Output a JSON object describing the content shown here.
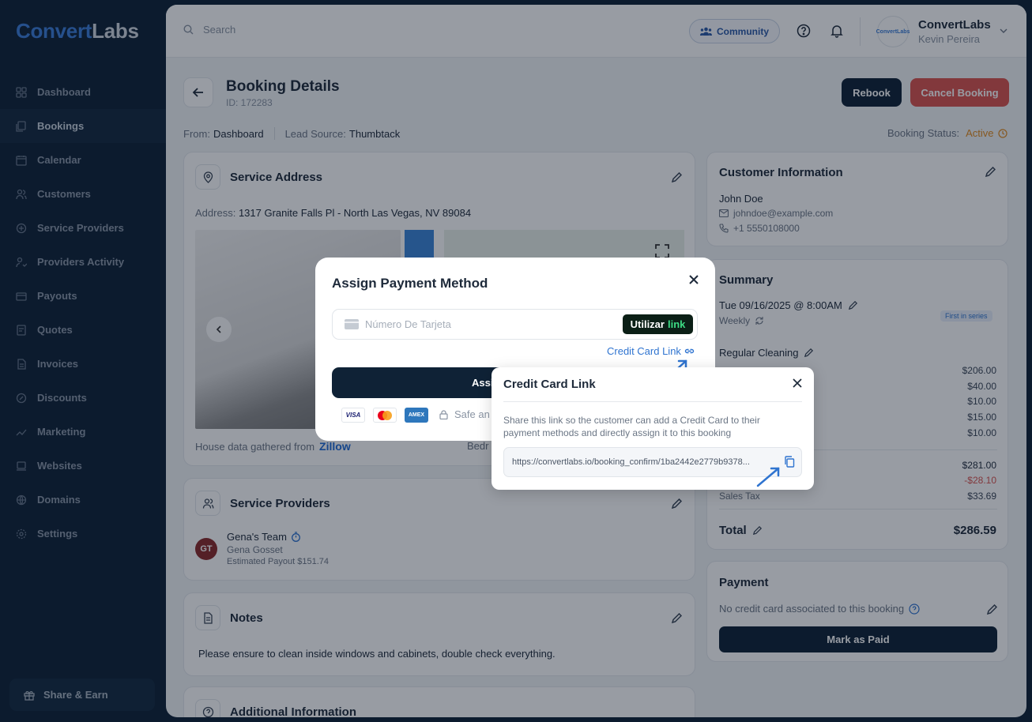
{
  "brand": {
    "part1": "Convert",
    "part2": "Labs"
  },
  "sidebar": {
    "items": [
      {
        "label": "Dashboard"
      },
      {
        "label": "Bookings"
      },
      {
        "label": "Calendar"
      },
      {
        "label": "Customers"
      },
      {
        "label": "Service Providers"
      },
      {
        "label": "Providers Activity"
      },
      {
        "label": "Payouts"
      },
      {
        "label": "Quotes"
      },
      {
        "label": "Invoices"
      },
      {
        "label": "Discounts"
      },
      {
        "label": "Marketing"
      },
      {
        "label": "Websites"
      },
      {
        "label": "Domains"
      },
      {
        "label": "Settings"
      }
    ],
    "share_label": "Share & Earn"
  },
  "topbar": {
    "search_placeholder": "Search",
    "community_label": "Community",
    "avatar_text": "ConvertLabs",
    "user_company": "ConvertLabs",
    "user_name": "Kevin Pereira"
  },
  "page": {
    "title": "Booking Details",
    "id": "ID: 172283",
    "rebook": "Rebook",
    "cancel": "Cancel Booking",
    "from_label": "From:",
    "from_value": "Dashboard",
    "lead_label": "Lead Source:",
    "lead_value": "Thumbtack",
    "status_label": "Booking Status:",
    "status_value": "Active"
  },
  "service_address": {
    "title": "Service Address",
    "address_label": "Address:",
    "address": "1317 Granite Falls Pl - North Las Vegas, NV 89084",
    "house_data": "House data gathered from",
    "zillow": "Zillow",
    "bedrooms_partial": "Bedr"
  },
  "service_providers": {
    "title": "Service Providers",
    "initials": "GT",
    "team": "Gena's Team",
    "member": "Gena Gosset",
    "payout": "Estimated Payout $151.74"
  },
  "notes": {
    "title": "Notes",
    "text": "Please ensure to clean inside windows and cabinets, double check everything."
  },
  "additional": {
    "title": "Additional Information"
  },
  "customer": {
    "title": "Customer Information",
    "name": "John Doe",
    "email": "johndoe@example.com",
    "phone": "+1 5550108000"
  },
  "summary": {
    "title": "Summary",
    "date": "Tue 09/16/2025 @ 8:00AM",
    "frequency": "Weekly",
    "badge": "First in series",
    "service": "Regular Cleaning",
    "line_amounts": [
      "$206.00",
      "$40.00",
      "$10.00",
      "$15.00",
      "$10.00"
    ],
    "subtotal": "$281.00",
    "discount": "-$28.10",
    "tax_label": "Sales Tax",
    "tax": "$33.69",
    "total_label": "Total",
    "total": "$286.59"
  },
  "payment": {
    "title": "Payment",
    "no_card": "No credit card associated to this booking",
    "mark_paid": "Mark as Paid"
  },
  "modal": {
    "title": "Assign Payment Method",
    "card_placeholder": "Número De Tarjeta",
    "link_btn_a": "Utilizar",
    "link_btn_b": "link",
    "cc_link": "Credit Card Link",
    "assign_partial": "Assi",
    "safe_partial": "Safe an"
  },
  "popover": {
    "title": "Credit Card Link",
    "description": "Share this link so the customer can add a Credit Card to their payment methods and directly assign it to this booking",
    "url": "https://convertlabs.io/booking_confirm/1ba2442e2779b9378..."
  },
  "colors": {
    "accent": "#2f74d0",
    "navy": "#0f2236",
    "danger": "#d9534f",
    "active": "#e08a1e"
  }
}
